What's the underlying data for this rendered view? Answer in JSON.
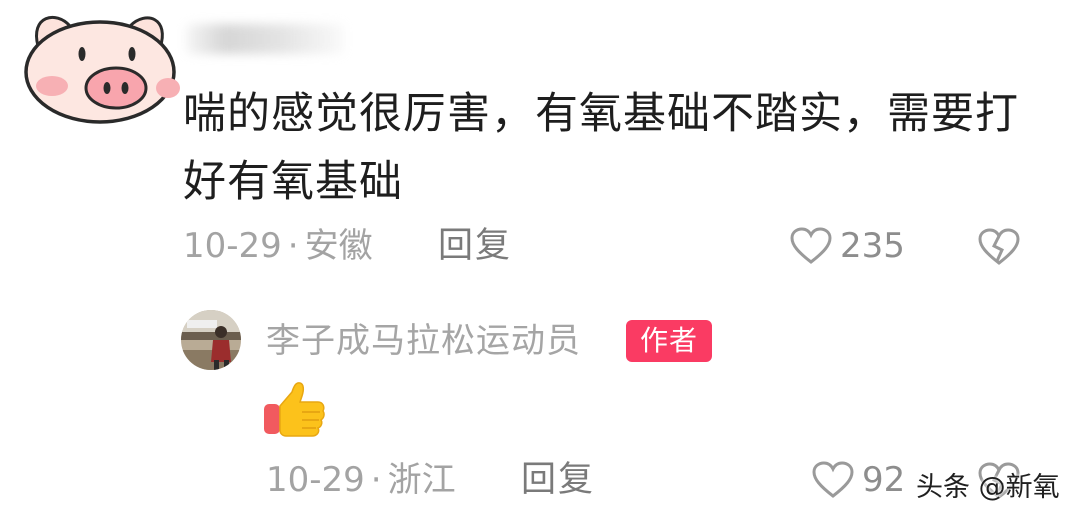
{
  "comment": {
    "text": "喘的感觉很厉害，有氧基础不踏实，需要打好有氧基础",
    "date": "10-29",
    "separator": "·",
    "location": "安徽",
    "reply_label": "回复",
    "like_count": "235",
    "avatar_icon": "pig-face-icon"
  },
  "author_reply": {
    "name": "李子成马拉松运动员",
    "badge": "作者",
    "emoji_icon": "thumbs-up-icon",
    "date": "10-29",
    "separator": "·",
    "location": "浙江",
    "reply_label": "回复",
    "like_count": "92"
  },
  "watermark": "头条 @新氧",
  "colors": {
    "text_primary": "#1e1e1e",
    "text_meta": "#a3a3a3",
    "badge_bg": "#fa3b63",
    "badge_text": "#ffffff",
    "background": "#ffffff"
  }
}
